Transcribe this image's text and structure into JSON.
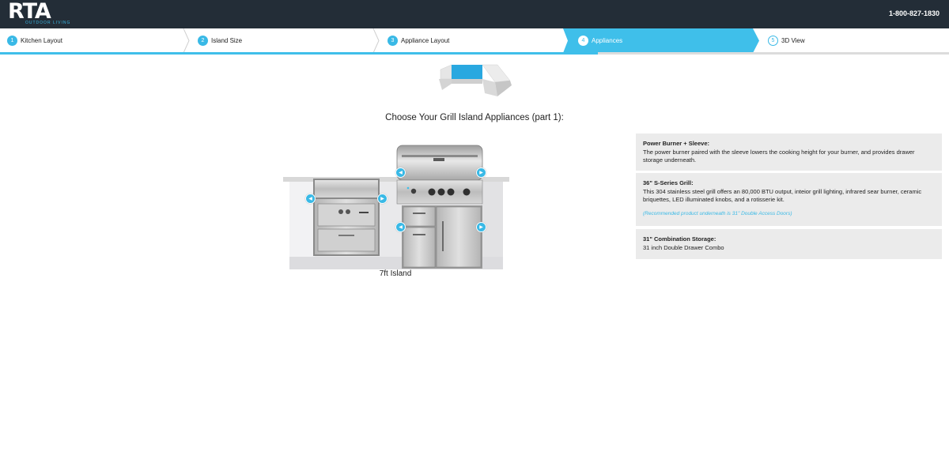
{
  "header": {
    "logo_text": "RTA",
    "logo_sub": "OUTDOOR LIVING",
    "phone": "1-800-827-1830"
  },
  "steps": [
    {
      "num": "1",
      "label": "Kitchen Layout"
    },
    {
      "num": "2",
      "label": "Island Size"
    },
    {
      "num": "3",
      "label": "Appliance Layout"
    },
    {
      "num": "4",
      "label": "Appliances"
    },
    {
      "num": "5",
      "label": "3D View"
    }
  ],
  "main": {
    "title": "Choose Your Grill Island Appliances (part 1):",
    "island_label": "7ft Island"
  },
  "panels": [
    {
      "title": "Power Burner + Sleeve:",
      "text": "The power burner paired with the sleeve lowers the cooking height for your burner, and provides drawer storage underneath."
    },
    {
      "title": "36\" S-Series Grill:",
      "text": "This 304 stainless steel grill offers an 80,000 BTU output, inteior grill lighting, infrared sear burner, ceramic briquettes, LED illuminated knobs, and a rotisserie kit.",
      "note": "(Recommended product underneath is 31\" Double Access Doors)"
    },
    {
      "title": "31\" Combination Storage:",
      "text": "31 inch Double Drawer Combo"
    }
  ],
  "colors": {
    "accent": "#3fbfea",
    "header_bg": "#232d37",
    "panel_bg": "#ebebeb"
  }
}
